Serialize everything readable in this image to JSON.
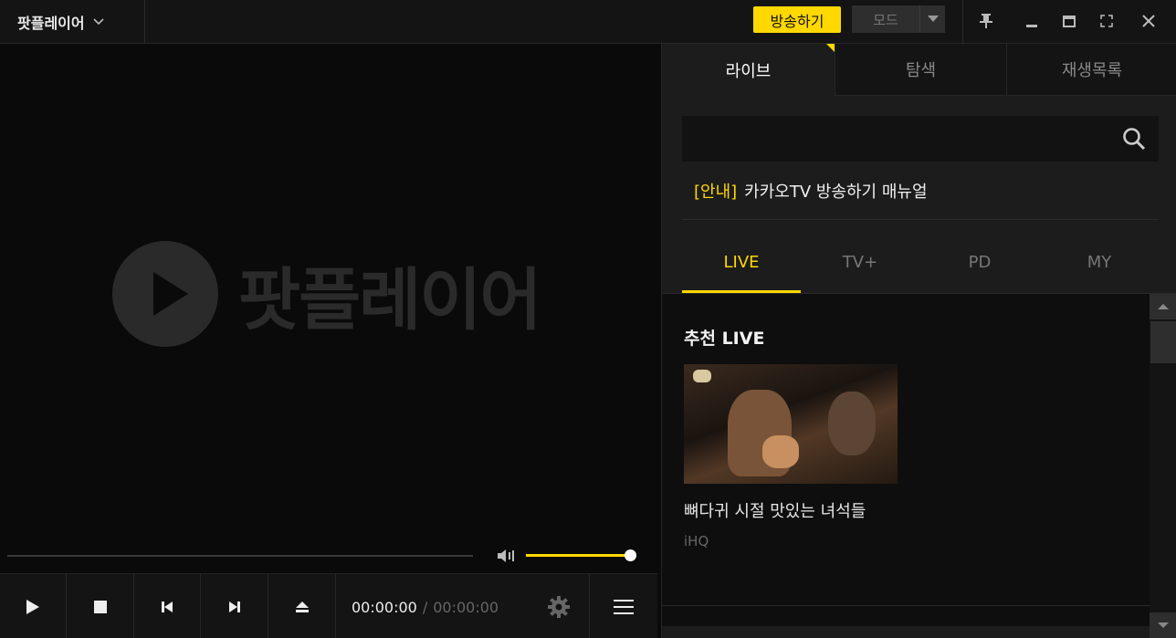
{
  "titlebar": {
    "app_name": "팟플레이어",
    "broadcast_label": "방송하기",
    "mode_label": "모드",
    "icons": [
      "chevron-down-icon",
      "pin-icon",
      "minimize-icon",
      "maximize-icon",
      "fullscreen-icon",
      "close-icon"
    ]
  },
  "player": {
    "logo_text": "팟플레이어",
    "time_current": "00:00:00",
    "time_separator": "/",
    "time_total": "00:00:00",
    "volume_level": 1.0,
    "seek_progress": 0.0,
    "controls": [
      "play-icon",
      "stop-icon",
      "previous-icon",
      "next-icon",
      "eject-icon",
      "gear-icon",
      "menu-icon"
    ]
  },
  "panel": {
    "tabs": [
      {
        "label": "라이브",
        "active": true
      },
      {
        "label": "탐색",
        "active": false
      },
      {
        "label": "재생목록",
        "active": false
      }
    ],
    "search_placeholder": "",
    "notice": {
      "tag": "[안내]",
      "text": "카카오TV 방송하기 매뉴얼"
    },
    "subtabs": [
      {
        "label": "LIVE",
        "active": true
      },
      {
        "label": "TV+",
        "active": false
      },
      {
        "label": "PD",
        "active": false
      },
      {
        "label": "MY",
        "active": false
      }
    ],
    "section_title": "추천 LIVE",
    "cards": [
      {
        "title": "뼈다귀 시절 맛있는 녀석들",
        "channel": "iHQ"
      }
    ]
  },
  "colors": {
    "accent": "#ffd800",
    "background": "#0a0a0a",
    "panel": "#1c1c1c"
  }
}
